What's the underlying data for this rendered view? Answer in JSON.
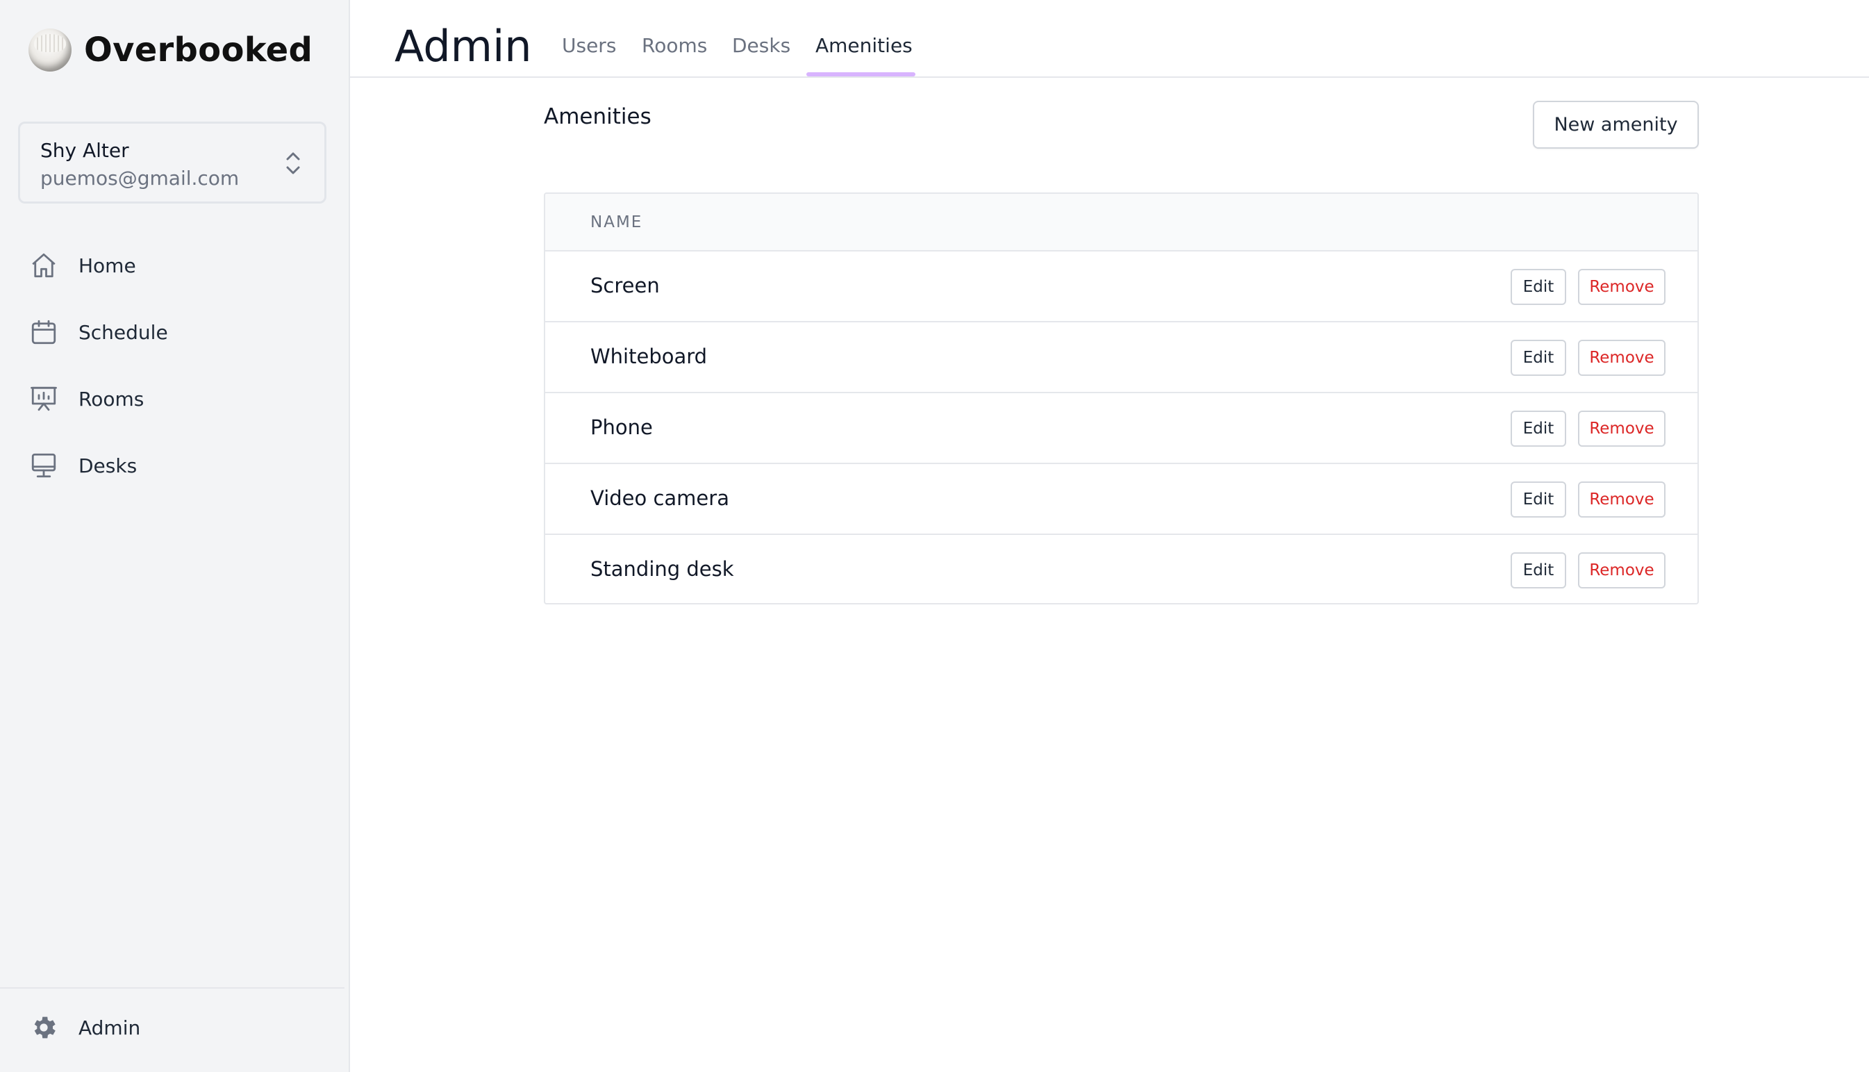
{
  "app": {
    "name": "Overbooked"
  },
  "user": {
    "name": "Shy Alter",
    "email": "puemos@gmail.com"
  },
  "sidebar": {
    "items": [
      {
        "label": "Home",
        "icon": "home-icon"
      },
      {
        "label": "Schedule",
        "icon": "calendar-icon"
      },
      {
        "label": "Rooms",
        "icon": "presentation-icon"
      },
      {
        "label": "Desks",
        "icon": "desk-icon"
      }
    ],
    "footer": {
      "label": "Admin",
      "icon": "gear-icon"
    }
  },
  "header": {
    "title": "Admin",
    "tabs": [
      {
        "label": "Users",
        "active": false
      },
      {
        "label": "Rooms",
        "active": false
      },
      {
        "label": "Desks",
        "active": false
      },
      {
        "label": "Amenities",
        "active": true
      }
    ]
  },
  "main": {
    "section_title": "Amenities",
    "new_button": "New amenity",
    "table": {
      "column_header": "NAME",
      "rows": [
        {
          "name": "Screen",
          "edit": "Edit",
          "remove": "Remove"
        },
        {
          "name": "Whiteboard",
          "edit": "Edit",
          "remove": "Remove"
        },
        {
          "name": "Phone",
          "edit": "Edit",
          "remove": "Remove"
        },
        {
          "name": "Video camera",
          "edit": "Edit",
          "remove": "Remove"
        },
        {
          "name": "Standing desk",
          "edit": "Edit",
          "remove": "Remove"
        }
      ]
    }
  },
  "colors": {
    "sidebar_bg": "#f3f4f6",
    "accent_tab_underline": "#d8b4fe",
    "danger": "#dc2626",
    "border": "#e5e7eb"
  }
}
